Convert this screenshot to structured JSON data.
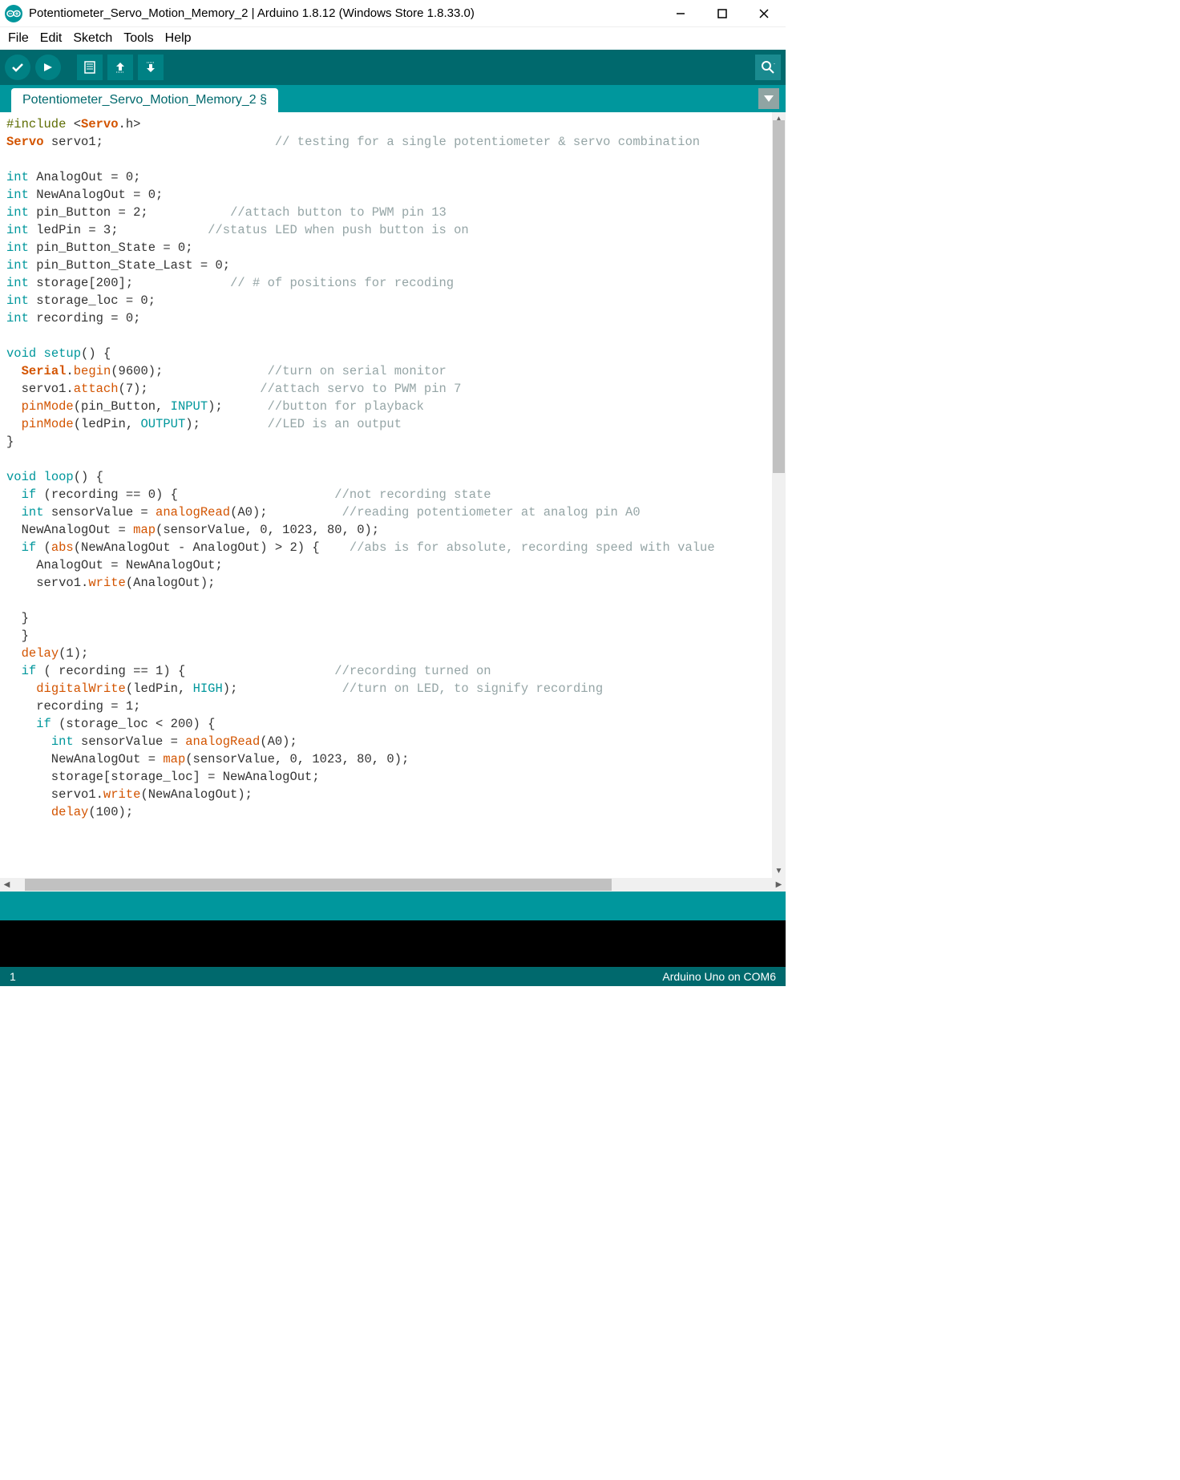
{
  "window": {
    "title": "Potentiometer_Servo_Motion_Memory_2 | Arduino 1.8.12 (Windows Store 1.8.33.0)"
  },
  "menu": {
    "file": "File",
    "edit": "Edit",
    "sketch": "Sketch",
    "tools": "Tools",
    "help": "Help"
  },
  "tab": {
    "name": "Potentiometer_Servo_Motion_Memory_2 §"
  },
  "status": {
    "left": "1",
    "right": "Arduino Uno on COM6"
  },
  "code": {
    "l1a": "#include",
    "l1b": " <",
    "l1c": "Servo",
    "l1d": ".h>",
    "l2a": "Servo",
    "l2b": " servo1;                       ",
    "l2c": "// testing for a single potentiometer & servo combination",
    "l3": "",
    "l4a": "int",
    "l4b": " AnalogOut = 0;",
    "l5a": "int",
    "l5b": " NewAnalogOut = 0;",
    "l6a": "int",
    "l6b": " pin_Button = 2;           ",
    "l6c": "//attach button to PWM pin 13",
    "l7a": "int",
    "l7b": " ledPin = 3;            ",
    "l7c": "//status LED when push button is on",
    "l8a": "int",
    "l8b": " pin_Button_State = 0;",
    "l9a": "int",
    "l9b": " pin_Button_State_Last = 0;",
    "l10a": "int",
    "l10b": " storage[200];             ",
    "l10c": "// # of positions for recoding",
    "l11a": "int",
    "l11b": " storage_loc = 0;",
    "l12a": "int",
    "l12b": " recording = 0;",
    "l13": "",
    "l14a": "void",
    "l14b": " ",
    "l14c": "setup",
    "l14d": "() {",
    "l15a": "  ",
    "l15b": "Serial",
    "l15c": ".",
    "l15d": "begin",
    "l15e": "(9600);              ",
    "l15f": "//turn on serial monitor",
    "l16a": "  servo1.",
    "l16b": "attach",
    "l16c": "(7);               ",
    "l16d": "//attach servo to PWM pin 7",
    "l17a": "  ",
    "l17b": "pinMode",
    "l17c": "(pin_Button, ",
    "l17d": "INPUT",
    "l17e": ");      ",
    "l17f": "//button for playback",
    "l18a": "  ",
    "l18b": "pinMode",
    "l18c": "(ledPin, ",
    "l18d": "OUTPUT",
    "l18e": ");         ",
    "l18f": "//LED is an output",
    "l19": "}",
    "l20": "",
    "l21a": "void",
    "l21b": " ",
    "l21c": "loop",
    "l21d": "() {",
    "l22a": "  ",
    "l22b": "if",
    "l22c": " (recording == 0) {                     ",
    "l22d": "//not recording state",
    "l23a": "  ",
    "l23b": "int",
    "l23c": " sensorValue = ",
    "l23d": "analogRead",
    "l23e": "(A0);          ",
    "l23f": "//reading potentiometer at analog pin A0",
    "l24a": "  NewAnalogOut = ",
    "l24b": "map",
    "l24c": "(sensorValue, 0, 1023, 80, 0);",
    "l25a": "  ",
    "l25b": "if",
    "l25c": " (",
    "l25d": "abs",
    "l25e": "(NewAnalogOut - AnalogOut) > 2) {    ",
    "l25f": "//abs is for absolute, recording speed with value",
    "l26": "    AnalogOut = NewAnalogOut;",
    "l27a": "    servo1.",
    "l27b": "write",
    "l27c": "(AnalogOut);",
    "l28": "",
    "l29": "  }",
    "l30": "  }",
    "l31a": "  ",
    "l31b": "delay",
    "l31c": "(1);",
    "l32a": "  ",
    "l32b": "if",
    "l32c": " ( recording == 1) {                    ",
    "l32d": "//recording turned on",
    "l33a": "    ",
    "l33b": "digitalWrite",
    "l33c": "(ledPin, ",
    "l33d": "HIGH",
    "l33e": ");              ",
    "l33f": "//turn on LED, to signify recording",
    "l34": "    recording = 1;",
    "l35a": "    ",
    "l35b": "if",
    "l35c": " (storage_loc < 200) {",
    "l36a": "      ",
    "l36b": "int",
    "l36c": " sensorValue = ",
    "l36d": "analogRead",
    "l36e": "(A0);",
    "l37a": "      NewAnalogOut = ",
    "l37b": "map",
    "l37c": "(sensorValue, 0, 1023, 80, 0);",
    "l38": "      storage[storage_loc] = NewAnalogOut;",
    "l39a": "      servo1.",
    "l39b": "write",
    "l39c": "(NewAnalogOut);",
    "l40a": "      ",
    "l40b": "delay",
    "l40c": "(100);"
  }
}
